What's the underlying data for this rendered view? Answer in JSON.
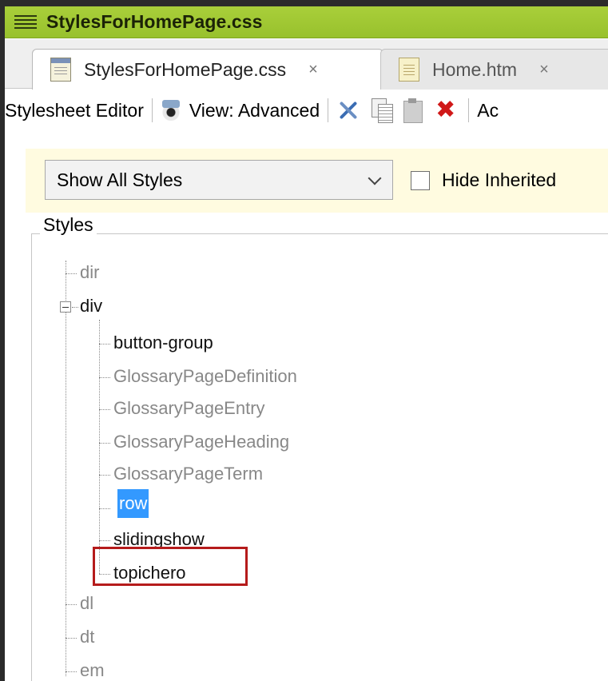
{
  "window": {
    "title": "StylesForHomePage.css"
  },
  "tabs": [
    {
      "label": "StylesForHomePage.css",
      "close": "×",
      "active": true
    },
    {
      "label": "Home.htm",
      "close": "×",
      "active": false
    }
  ],
  "toolbar": {
    "editor_label": "Stylesheet Editor",
    "view_label": "View: Advanced",
    "trailing_label": "Ac"
  },
  "filter": {
    "dropdown_value": "Show All Styles",
    "checkbox_label": "Hide Inherited",
    "checkbox_checked": false
  },
  "styles_group": {
    "legend": "Styles"
  },
  "tree": {
    "dir": "dir",
    "div": "div",
    "div_children": [
      "button-group",
      "GlossaryPageDefinition",
      "GlossaryPageEntry",
      "GlossaryPageHeading",
      "GlossaryPageTerm",
      "row",
      "slidingshow",
      "topichero"
    ],
    "dl": "dl",
    "dt": "dt",
    "em": "em"
  },
  "colors": {
    "titlebar": "#a9cf3a",
    "selection": "#3399ff",
    "highlight_border": "#b51b1b",
    "filter_background": "#fffbe0"
  }
}
